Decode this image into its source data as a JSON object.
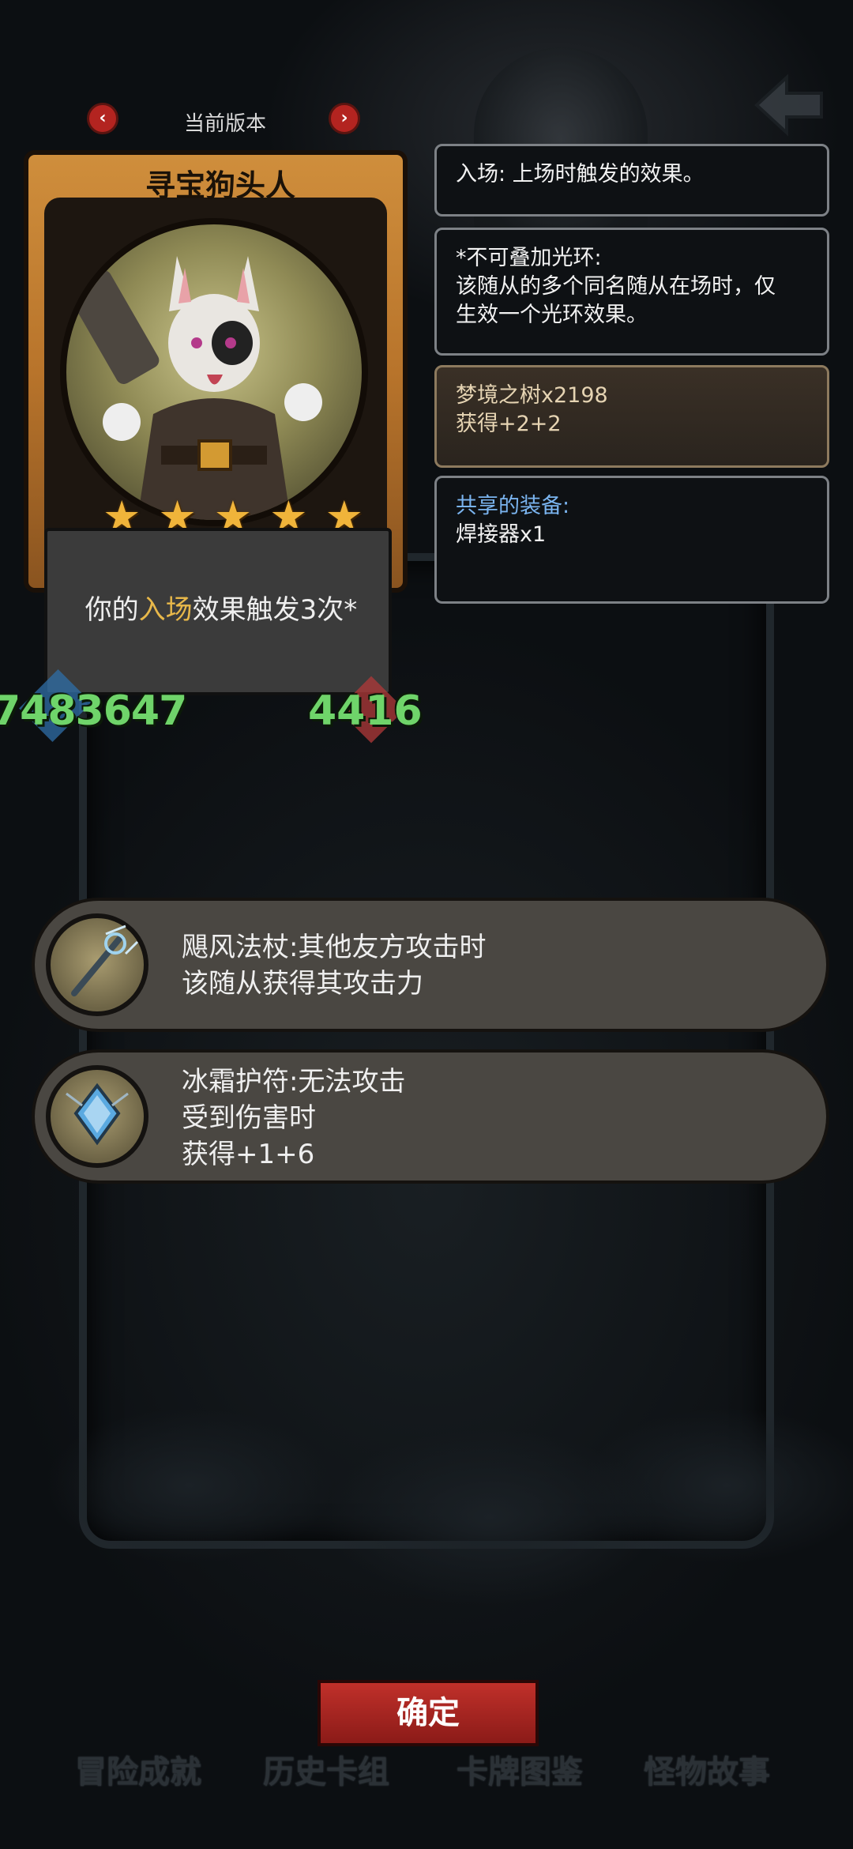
{
  "header": {
    "version_label": "当前版本",
    "prev_symbol": "‹",
    "next_symbol": "›"
  },
  "card": {
    "name": "寻宝狗头人",
    "stars": 5,
    "star_glyph": "★",
    "text_prefix": "你的",
    "text_keyword": "入场",
    "text_suffix": "效果触发3次*",
    "attack": "7483647",
    "health": "4416"
  },
  "info_panels": [
    {
      "lines": [
        "入场: 上场时触发的效果。"
      ]
    },
    {
      "lines": [
        "*不可叠加光环:",
        "该随从的多个同名随从在场时，仅",
        "生效一个光环效果。"
      ]
    },
    {
      "lines": [
        "梦境之树x2198",
        "获得+2+2"
      ]
    },
    {
      "title": "共享的装备:",
      "lines": [
        "焊接器x1"
      ]
    }
  ],
  "equipment": [
    {
      "lines": [
        "飓风法杖:其他友方攻击时",
        "该随从获得其攻击力"
      ],
      "icon": "staff-icon"
    },
    {
      "lines": [
        "冰霜护符:无法攻击",
        "受到伤害时",
        "获得+1+6"
      ],
      "icon": "frost-amulet-icon"
    }
  ],
  "confirm_label": "确定",
  "bottom_tabs": [
    "冒险成就",
    "历史卡组",
    "卡牌图鉴",
    "怪物故事"
  ],
  "colors": {
    "accent_red": "#b32420",
    "keyword_gold": "#e8b84a",
    "stat_green": "#6fd46a",
    "shared_blue": "#7ab4ef"
  }
}
